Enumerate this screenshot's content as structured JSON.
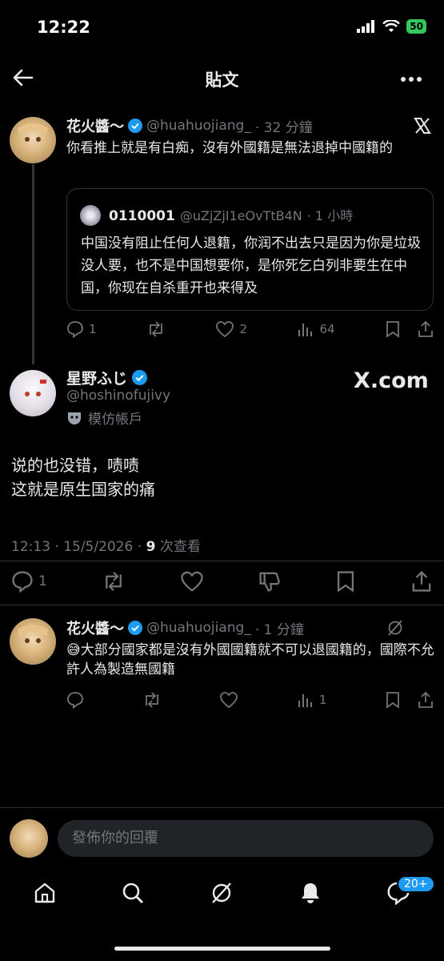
{
  "status_bar": {
    "time": "12:22",
    "battery": "50"
  },
  "header": {
    "title": "貼文"
  },
  "tweet1": {
    "name": "花火醬～",
    "handle": "@huahuojiang_",
    "time": "· 32 分鐘",
    "text": "你看推上就是有白痴，沒有外國籍是無法退掉中國籍的",
    "quote": {
      "name": "0110001",
      "handle": "@uZjZjI1eOvTtB4N",
      "time": "· 1 小時",
      "text": "中国没有阻止任何人退籍，你润不出去只是因为你是垃圾没人要，也不是中国想要你，是你死乞白列非要生在中国，你现在自杀重开也来得及"
    },
    "replies": "1",
    "likes": "2",
    "views": "64"
  },
  "main_post": {
    "name": "星野ふじ",
    "handle": "@hoshinofujivy",
    "parody_label": "模仿帳戶",
    "watermark": "X.com",
    "line1": "说的也没错，啧啧",
    "line2": "这就是原生国家的痛",
    "meta_time": "12:13 · 15/5/2026 · ",
    "meta_views": "9",
    "meta_views_label": " 次查看",
    "replies": "1"
  },
  "reply1": {
    "name": "花火醬～",
    "handle": "@huahuojiang_",
    "time": "· 1 分鐘",
    "emoji": "😅",
    "text": "大部分國家都是沒有外國國籍就不可以退國籍的，國際不允許人為製造無國籍",
    "views": "1"
  },
  "composer": {
    "placeholder": "發佈你的回覆"
  },
  "tabbar": {
    "notif_badge": "20+"
  },
  "colors": {
    "verified": "#1d9bf0",
    "muted": "#71767b",
    "border": "#2f3336"
  }
}
